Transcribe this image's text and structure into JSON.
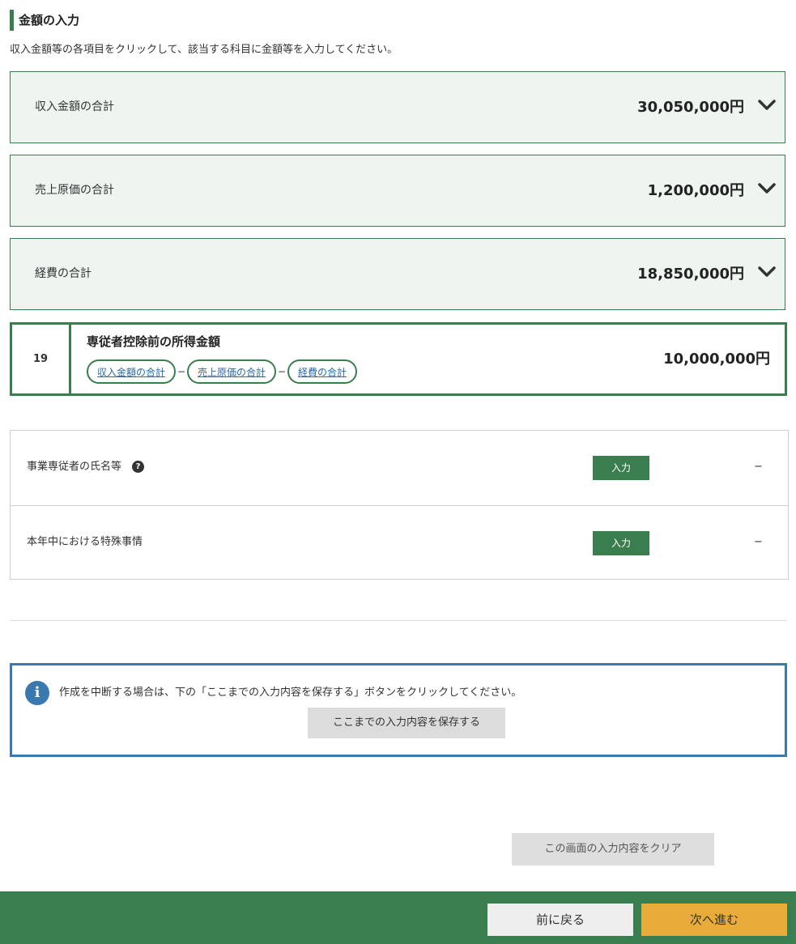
{
  "section": {
    "title": "金額の入力",
    "instruction": "収入金額等の各項目をクリックして、該当する科目に金額等を入力してください。"
  },
  "accordions": [
    {
      "label": "収入金額の合計",
      "amount": "30,050,000円",
      "icon": "chevron-down-icon"
    },
    {
      "label": "売上原価の合計",
      "amount": "1,200,000円",
      "icon": "chevron-down-icon"
    },
    {
      "label": "経費の合計",
      "amount": "18,850,000円",
      "icon": "chevron-down-icon"
    }
  ],
  "result": {
    "number": "19",
    "title": "専従者控除前の所得金額",
    "chips": [
      "収入金額の合計",
      "売上原価の合計",
      "経費の合計"
    ],
    "operator": "−",
    "amount": "10,000,000円"
  },
  "table": {
    "rows": [
      {
        "label": "事業専従者の氏名等",
        "help": "?",
        "button": "入力",
        "value": "−"
      },
      {
        "label": "本年中における特殊事情",
        "button": "入力",
        "value": "−"
      }
    ]
  },
  "info": {
    "icon": "i",
    "text": "作成を中断する場合は、下の「ここまでの入力内容を保存する」ボタンをクリックしてください。",
    "save_label": "ここまでの入力内容を保存する"
  },
  "clear_label": "この画面の入力内容をクリア",
  "footer": {
    "back_label": "前に戻る",
    "next_label": "次へ進む"
  },
  "colors": {
    "brand_green": "#3a7d4f",
    "accordion_bg": "#eef5f0",
    "info_blue": "#3a78b0",
    "next_orange": "#e9ac38"
  }
}
